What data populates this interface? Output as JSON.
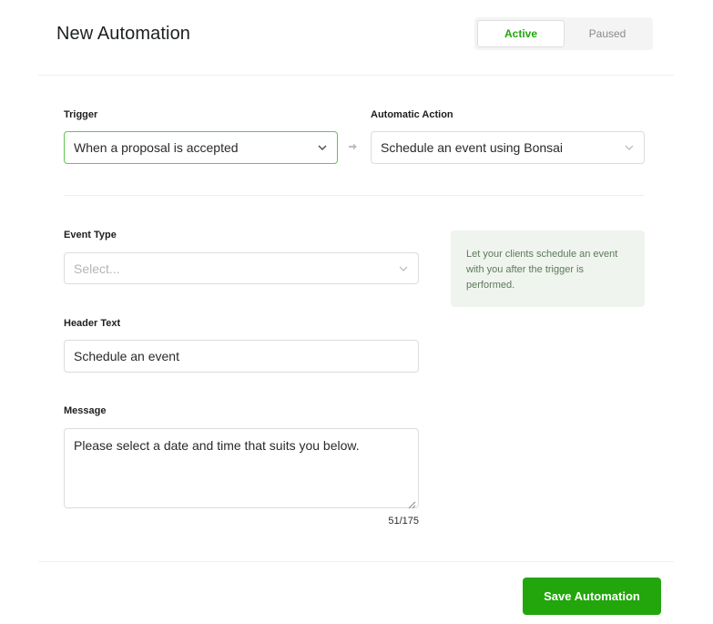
{
  "header": {
    "title": "New Automation",
    "status_options": [
      "Active",
      "Paused"
    ],
    "status_selected": "Active"
  },
  "trigger": {
    "label": "Trigger",
    "value": "When a proposal is accepted",
    "icon": "chevron-down-icon"
  },
  "action": {
    "label": "Automatic Action",
    "value": "Schedule an event using Bonsai",
    "icon": "chevron-down-icon",
    "connector_icon": "arrow-right-icon"
  },
  "event_type": {
    "label": "Event Type",
    "placeholder": "Select...",
    "value": ""
  },
  "info": {
    "text": "Let your clients schedule an event with you after the trigger is performed."
  },
  "header_text": {
    "label": "Header Text",
    "value": "Schedule an event"
  },
  "message": {
    "label": "Message",
    "value": "Please select a date and time that suits you below.",
    "counter": "51/175"
  },
  "footer": {
    "save_label": "Save Automation"
  },
  "colors": {
    "accent": "#22a60b",
    "active_text": "#1fa80a",
    "focus_border": "#62c553",
    "info_bg": "#eff5ee"
  }
}
